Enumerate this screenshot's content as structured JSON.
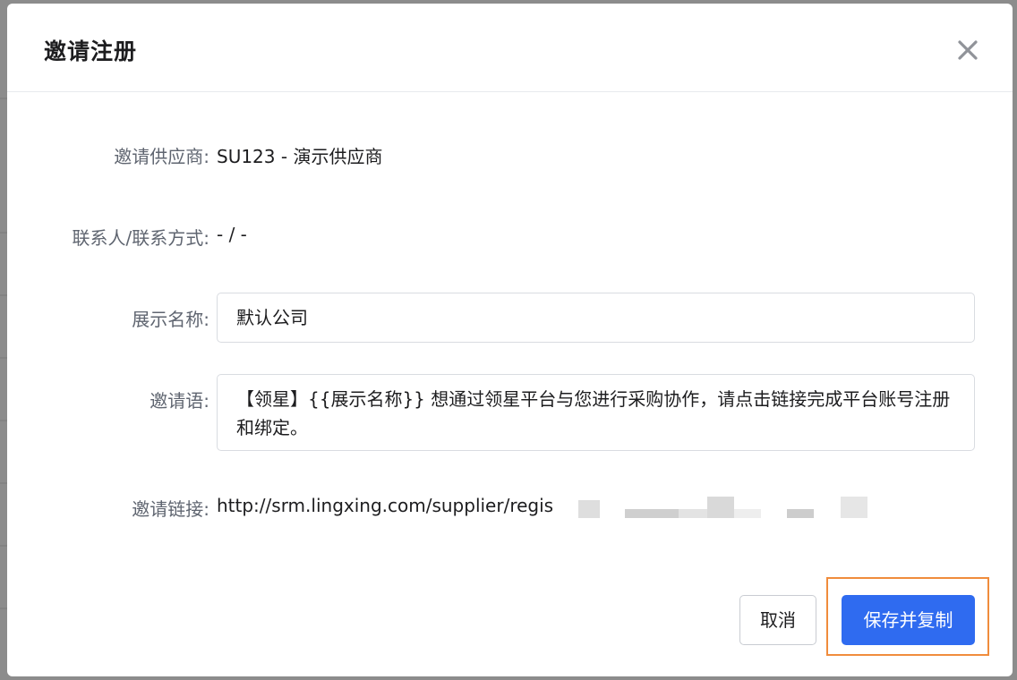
{
  "dialog": {
    "title": "邀请注册",
    "close_icon": "close-icon"
  },
  "form": {
    "supplier": {
      "label": "邀请供应商:",
      "value": "SU123 - 演示供应商"
    },
    "contact": {
      "label": "联系人/联系方式:",
      "value": "- / -"
    },
    "display_name": {
      "label": "展示名称:",
      "value": "默认公司"
    },
    "invite_message": {
      "label": "邀请语:",
      "value": "【领星】{{展示名称}} 想通过领星平台与您进行采购协作，请点击链接完成平台账号注册和绑定。"
    },
    "invite_link": {
      "label": "邀请链接:",
      "value": "http://srm.lingxing.com/supplier/regis"
    }
  },
  "footer": {
    "cancel_label": "取消",
    "save_copy_label": "保存并复制"
  },
  "colors": {
    "primary": "#2f6bf0",
    "highlight": "#f08c3c"
  }
}
